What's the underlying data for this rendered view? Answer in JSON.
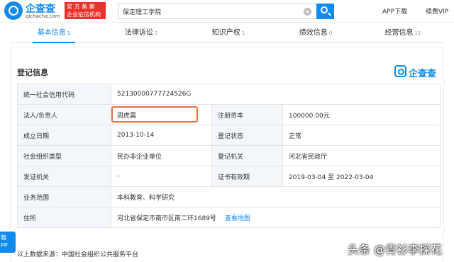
{
  "header": {
    "logo_name": "企查查",
    "logo_domain": "qichacha.com",
    "official_line1": "官 方 备 案",
    "official_line2": "企业征信机构",
    "search_value": "保定理工学院",
    "links": [
      "APP下载",
      "续费VIP"
    ]
  },
  "tabs": [
    {
      "label": "基本信息",
      "count": "1"
    },
    {
      "label": "法律诉讼",
      "count": "0"
    },
    {
      "label": "知识产权",
      "count": "1"
    },
    {
      "label": "绩效信息",
      "count": "0"
    },
    {
      "label": "经营信息",
      "count": "11"
    }
  ],
  "section": {
    "title": "登记信息",
    "badge": "企查查"
  },
  "rows": {
    "credit_code": {
      "label": "统一社会信用代码",
      "value": "52130000777724526G"
    },
    "legal_rep": {
      "label": "法人/负责人",
      "value": "周虎震"
    },
    "capital": {
      "label": "注册资本",
      "value": "100000.00元"
    },
    "founded": {
      "label": "成立日期",
      "value": "2013-10-14"
    },
    "status": {
      "label": "登记状态",
      "value": "正常"
    },
    "org_type": {
      "label": "社会组织类型",
      "value": "民办非企业单位"
    },
    "authority": {
      "label": "登记机关",
      "value": "河北省民政厅"
    },
    "issuer": {
      "label": "发证机关",
      "value": "-"
    },
    "validity": {
      "label": "证书有效期",
      "value": "2019-03-04 至 2022-03-04"
    },
    "scope": {
      "label": "业务范围",
      "value": "本科教育、科学研究"
    },
    "address": {
      "label": "住所",
      "value": "河北省保定市南市区南二环1689号",
      "link": "查看地图"
    }
  },
  "source_note": "以上数据来源：中国社会组织公共服务平台",
  "app_float": [
    "载",
    "PP"
  ],
  "watermark": "头条 @青衫李探花"
}
